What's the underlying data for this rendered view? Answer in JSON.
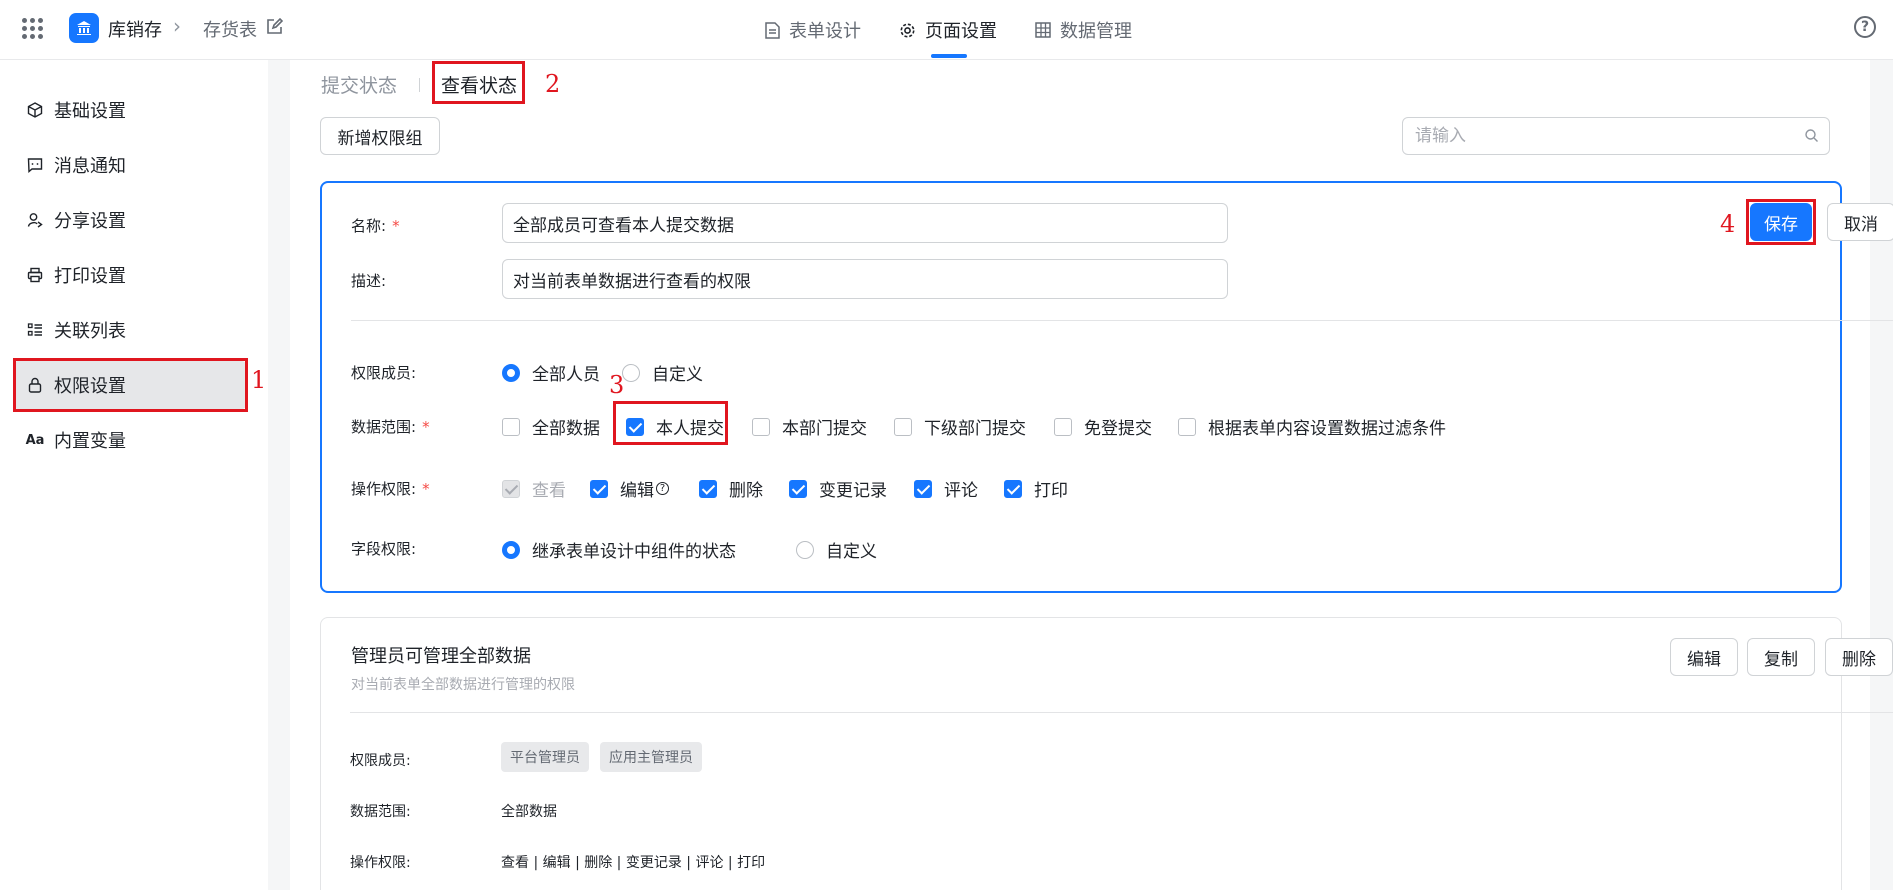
{
  "header": {
    "app_name": "库销存",
    "breadcrumb_sep": "›",
    "page_name": "存货表",
    "tabs": [
      {
        "label": "表单设计",
        "icon": "document-icon"
      },
      {
        "label": "页面设置",
        "icon": "gear-icon"
      },
      {
        "label": "数据管理",
        "icon": "table-icon"
      }
    ],
    "help": "?"
  },
  "sidebar": {
    "items": [
      {
        "label": "基础设置",
        "icon": "cube-icon"
      },
      {
        "label": "消息通知",
        "icon": "message-icon"
      },
      {
        "label": "分享设置",
        "icon": "share-user-icon"
      },
      {
        "label": "打印设置",
        "icon": "printer-icon"
      },
      {
        "label": "关联列表",
        "icon": "list-icon"
      },
      {
        "label": "权限设置",
        "icon": "lock-icon",
        "active": true
      },
      {
        "label": "内置变量",
        "icon": "text-aa-icon",
        "glyph": "Aa"
      }
    ]
  },
  "annotations": {
    "n1": "1",
    "n2": "2",
    "n3": "3",
    "n4": "4"
  },
  "main": {
    "subtabs": [
      "提交状态",
      "查看状态"
    ],
    "add_group_button": "新增权限组",
    "search": {
      "placeholder": "请输入"
    }
  },
  "edit_card": {
    "name_label": "名称:",
    "name_value": "全部成员可查看本人提交数据",
    "desc_label": "描述:",
    "desc_value": "对当前表单数据进行查看的权限",
    "required_mark": "*",
    "save_button": "保存",
    "cancel_button": "取消",
    "members_label": "权限成员:",
    "members_options": [
      "全部人员",
      "自定义"
    ],
    "scope_label": "数据范围:",
    "scope_options": [
      "全部数据",
      "本人提交",
      "本部门提交",
      "下级部门提交",
      "免登提交",
      "根据表单内容设置数据过滤条件"
    ],
    "ops_label": "操作权限:",
    "ops_options": [
      "查看",
      "编辑",
      "删除",
      "变更记录",
      "评论",
      "打印"
    ],
    "ops_help": "?",
    "field_label": "字段权限:",
    "field_options": [
      "继承表单设计中组件的状态",
      "自定义"
    ]
  },
  "view_card": {
    "title": "管理员可管理全部数据",
    "desc": "对当前表单全部数据进行管理的权限",
    "edit_button": "编辑",
    "copy_button": "复制",
    "delete_button": "删除",
    "members_label": "权限成员:",
    "members_tags": [
      "平台管理员",
      "应用主管理员"
    ],
    "scope_label": "数据范围:",
    "scope_value": "全部数据",
    "ops_label": "操作权限:",
    "ops_value": "查看 | 编辑 | 删除 | 变更记录 | 评论 | 打印"
  }
}
